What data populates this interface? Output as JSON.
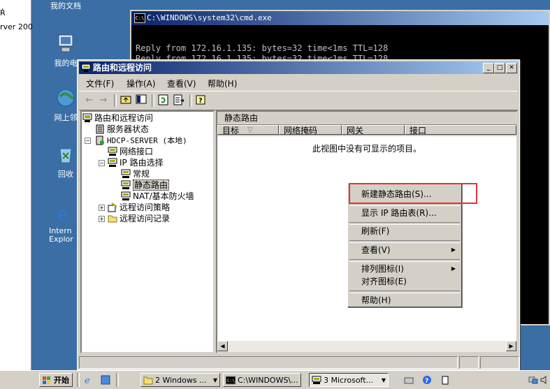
{
  "left_strip": {
    "line1": "Ŕ",
    "line2": "rver 200",
    "line3": "›"
  },
  "desktop": {
    "icons": [
      {
        "label": "我的文档"
      },
      {
        "label": "我的电"
      },
      {
        "label": "网上邻"
      },
      {
        "label": "回收"
      },
      {
        "label": "Intern Explor"
      }
    ]
  },
  "cmd": {
    "title": "C:\\WINDOWS\\system32\\cmd.exe",
    "icon_text": "C:\\",
    "lines": [
      "Reply from 172.16.1.135: bytes=32 time<1ms TTL=128",
      "Reply from 172.16.1.135: bytes=32 time<1ms TTL=128"
    ]
  },
  "window": {
    "title": "路由和远程访问",
    "menu": [
      "文件(F)",
      "操作(A)",
      "查看(V)",
      "帮助(H)"
    ],
    "tree": {
      "root": "路由和远程访问",
      "server_status": "服务器状态",
      "server": "HDCP-SERVER (本地)",
      "network_interfaces": "网络接口",
      "ip_routing": "IP 路由选择",
      "general": "常规",
      "static_routes": "静态路由",
      "nat": "NAT/基本防火墙",
      "remote_access_policy": "远程访问策略",
      "remote_access_logging": "远程访问记录"
    },
    "pane": {
      "header": "静态路由",
      "columns": [
        "目标",
        "网络掩码",
        "网关",
        "接口"
      ],
      "sort_indicator": "▽",
      "empty_message": "此视图中没有可显示的项目。"
    }
  },
  "context_menu": {
    "items": [
      {
        "label": "新建静态路由(S)..."
      },
      {
        "label": "显示 IP 路由表(R)..."
      },
      {
        "label": "刷新(F)"
      },
      {
        "label": "查看(V)",
        "submenu": true
      },
      {
        "label": "排列图标(I)",
        "submenu": true
      },
      {
        "label": "对齐图标(E)"
      },
      {
        "label": "帮助(H)"
      }
    ]
  },
  "taskbar": {
    "start": "开始",
    "buttons": [
      {
        "label": "2 Windows ..."
      },
      {
        "label": "C:\\WINDOWS\\..."
      },
      {
        "label": "3 Microsoft..."
      }
    ]
  },
  "colors": {
    "desktop": "#3a6ea5",
    "title_active": "#0a246a",
    "highlight_box": "#e53333"
  }
}
